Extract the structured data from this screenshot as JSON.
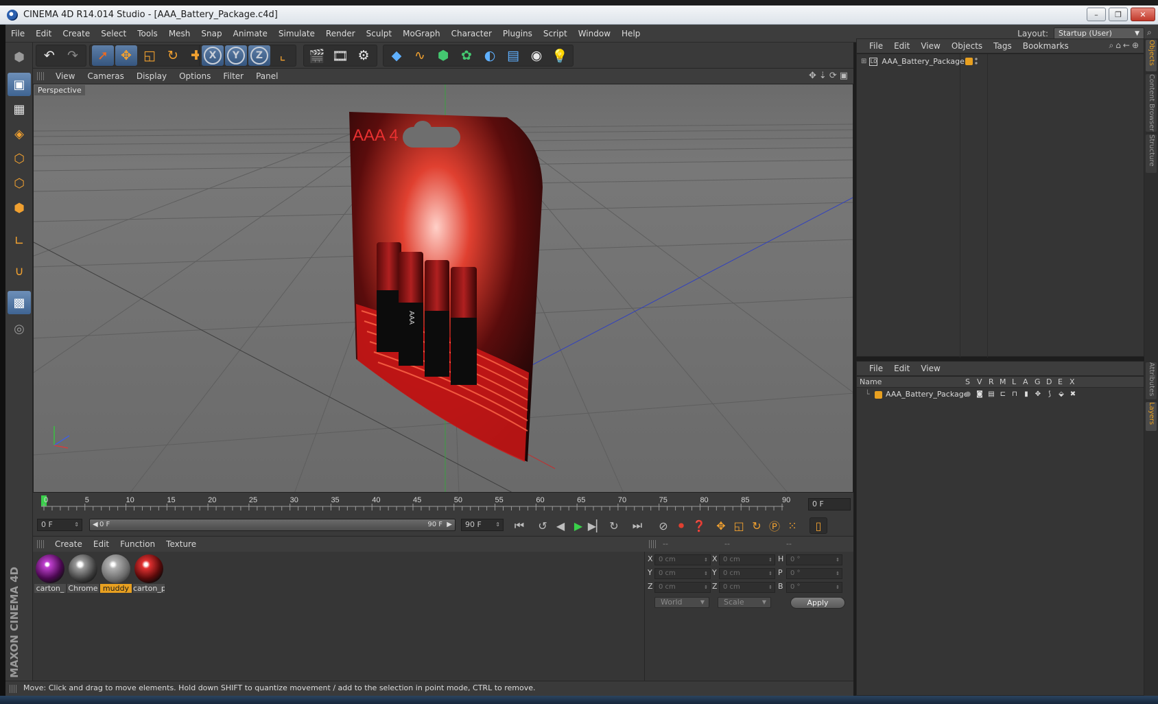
{
  "window": {
    "title": "CINEMA 4D R14.014 Studio - [AAA_Battery_Package.c4d]",
    "controls": [
      "–",
      "❐",
      "✕"
    ]
  },
  "menubar": {
    "items": [
      "File",
      "Edit",
      "Create",
      "Select",
      "Tools",
      "Mesh",
      "Snap",
      "Animate",
      "Simulate",
      "Render",
      "Sculpt",
      "MoGraph",
      "Character",
      "Plugins",
      "Script",
      "Window",
      "Help"
    ],
    "layout_label": "Layout:",
    "layout_value": "Startup (User)"
  },
  "left_toolbar": {
    "icons": [
      "model-mode-icon",
      "object-mode-icon",
      "texture-mode-icon",
      "workplane-icon",
      "points-mode-icon",
      "edges-mode-icon",
      "polygons-mode-icon",
      "axis-mode-icon",
      "magnet-icon",
      "grid-snap-icon",
      "soft-selection-icon"
    ]
  },
  "top_toolbar": {
    "icons": [
      "undo-icon",
      "redo-icon",
      "live-selection-icon",
      "move-icon",
      "scale-icon",
      "rotate-icon",
      "last-tool-icon",
      "x-axis-icon",
      "y-axis-icon",
      "z-axis-icon",
      "coordinate-system-icon",
      "render-view-icon",
      "render-picture-viewer-icon",
      "edit-render-settings-icon",
      "cube-icon",
      "spline-pen-icon",
      "nurbs-icon",
      "array-icon",
      "deformer-icon",
      "floor-icon",
      "camera-icon",
      "light-icon"
    ],
    "axis_labels": [
      "X",
      "Y",
      "Z"
    ]
  },
  "viewport": {
    "menu": [
      "View",
      "Cameras",
      "Display",
      "Options",
      "Filter",
      "Panel"
    ],
    "label": "Perspective",
    "package_text": "AAA 4",
    "battery_text": "AAA"
  },
  "timeline": {
    "ticks": [
      "0",
      "5",
      "10",
      "15",
      "20",
      "25",
      "30",
      "35",
      "40",
      "45",
      "50",
      "55",
      "60",
      "65",
      "70",
      "75",
      "80",
      "85",
      "90"
    ],
    "current_frame": "0 F"
  },
  "transport": {
    "start_field": "0 F",
    "range_start": "0 F",
    "range_end": "90 F",
    "end_field": "90 F"
  },
  "materials": {
    "menu": [
      "Create",
      "Edit",
      "Function",
      "Texture"
    ],
    "items": [
      {
        "name": "carton_",
        "selected": false
      },
      {
        "name": "Chrome",
        "selected": false
      },
      {
        "name": "muddy",
        "selected": true
      },
      {
        "name": "carton_p",
        "selected": false
      }
    ]
  },
  "coordinates": {
    "header": [
      "--",
      "--",
      "--"
    ],
    "rows": [
      {
        "pos_label": "X",
        "pos": "0 cm",
        "size_label": "X",
        "size": "0 cm",
        "rot_label": "H",
        "rot": "0 °"
      },
      {
        "pos_label": "Y",
        "pos": "0 cm",
        "size_label": "Y",
        "size": "0 cm",
        "rot_label": "P",
        "rot": "0 °"
      },
      {
        "pos_label": "Z",
        "pos": "0 cm",
        "size_label": "Z",
        "size": "0 cm",
        "rot_label": "B",
        "rot": "0 °"
      }
    ],
    "space": "World",
    "mode": "Scale",
    "apply": "Apply"
  },
  "status": {
    "text": "Move: Click and drag to move elements. Hold down SHIFT to quantize movement / add to the selection in point mode, CTRL to remove."
  },
  "objects_manager": {
    "menu": [
      "File",
      "Edit",
      "View",
      "Objects",
      "Tags",
      "Bookmarks"
    ],
    "object_name": "AAA_Battery_Package",
    "null_glyph": "L0"
  },
  "layers_manager": {
    "menu": [
      "File",
      "Edit",
      "View"
    ],
    "columns": [
      "Name",
      "S",
      "V",
      "R",
      "M",
      "L",
      "A",
      "G",
      "D",
      "E",
      "X"
    ],
    "layer_name": "AAA_Battery_Package"
  },
  "side_tabs": [
    "Objects",
    "Content Browser",
    "Structure",
    "Attributes",
    "Layers"
  ],
  "branding": {
    "logo": "MAXON CINEMA 4D"
  },
  "colors": {
    "accent": "#e8a020",
    "active_tool": "#4a6f9c",
    "panel": "#3a3a3a",
    "viewport": "#707070"
  }
}
